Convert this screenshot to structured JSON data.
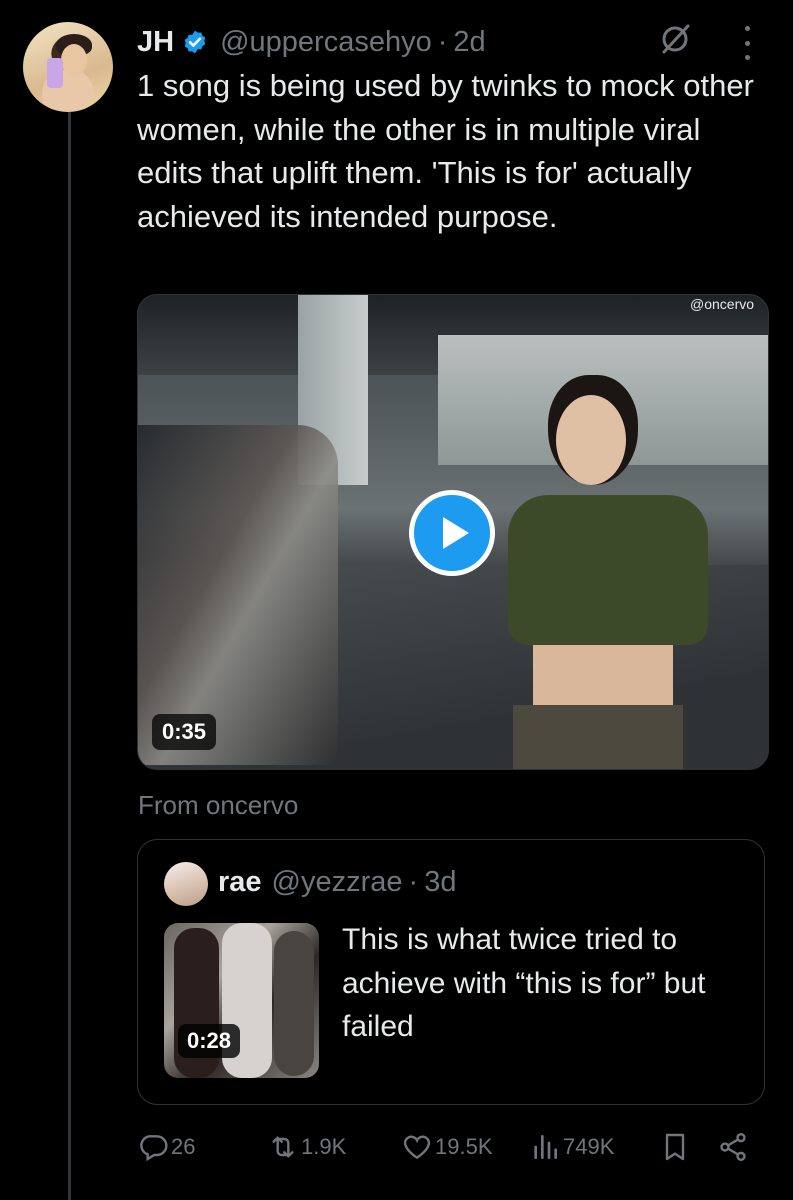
{
  "tweet": {
    "author_name": "JH",
    "author_handle": "@uppercasehyo",
    "separator": "·",
    "time": "2d",
    "text": "1 song is being used by twinks to mock other women, while the other is in multiple viral edits that uplift them. 'This is for' actually achieved its intended purpose.",
    "media": {
      "duration": "0:35",
      "watermark": "@oncervo",
      "icon": "play-icon"
    },
    "from_label": "From oncervo"
  },
  "quote": {
    "author_name": "rae",
    "author_handle": "@yezzrae",
    "separator": "·",
    "time": "3d",
    "text": "This is what twice tried to achieve with “this is for” but failed",
    "thumb_duration": "0:28"
  },
  "actions": {
    "replies": "26",
    "reposts": "1.9K",
    "likes": "19.5K",
    "views": "749K",
    "icons": [
      "reply-icon",
      "repost-icon",
      "like-icon",
      "views-icon",
      "bookmark-icon",
      "share-icon"
    ]
  },
  "colors": {
    "background": "#000000",
    "text": "#e7e9ea",
    "muted": "#71767b",
    "accent": "#1d9bf0",
    "border": "#2f3336"
  }
}
